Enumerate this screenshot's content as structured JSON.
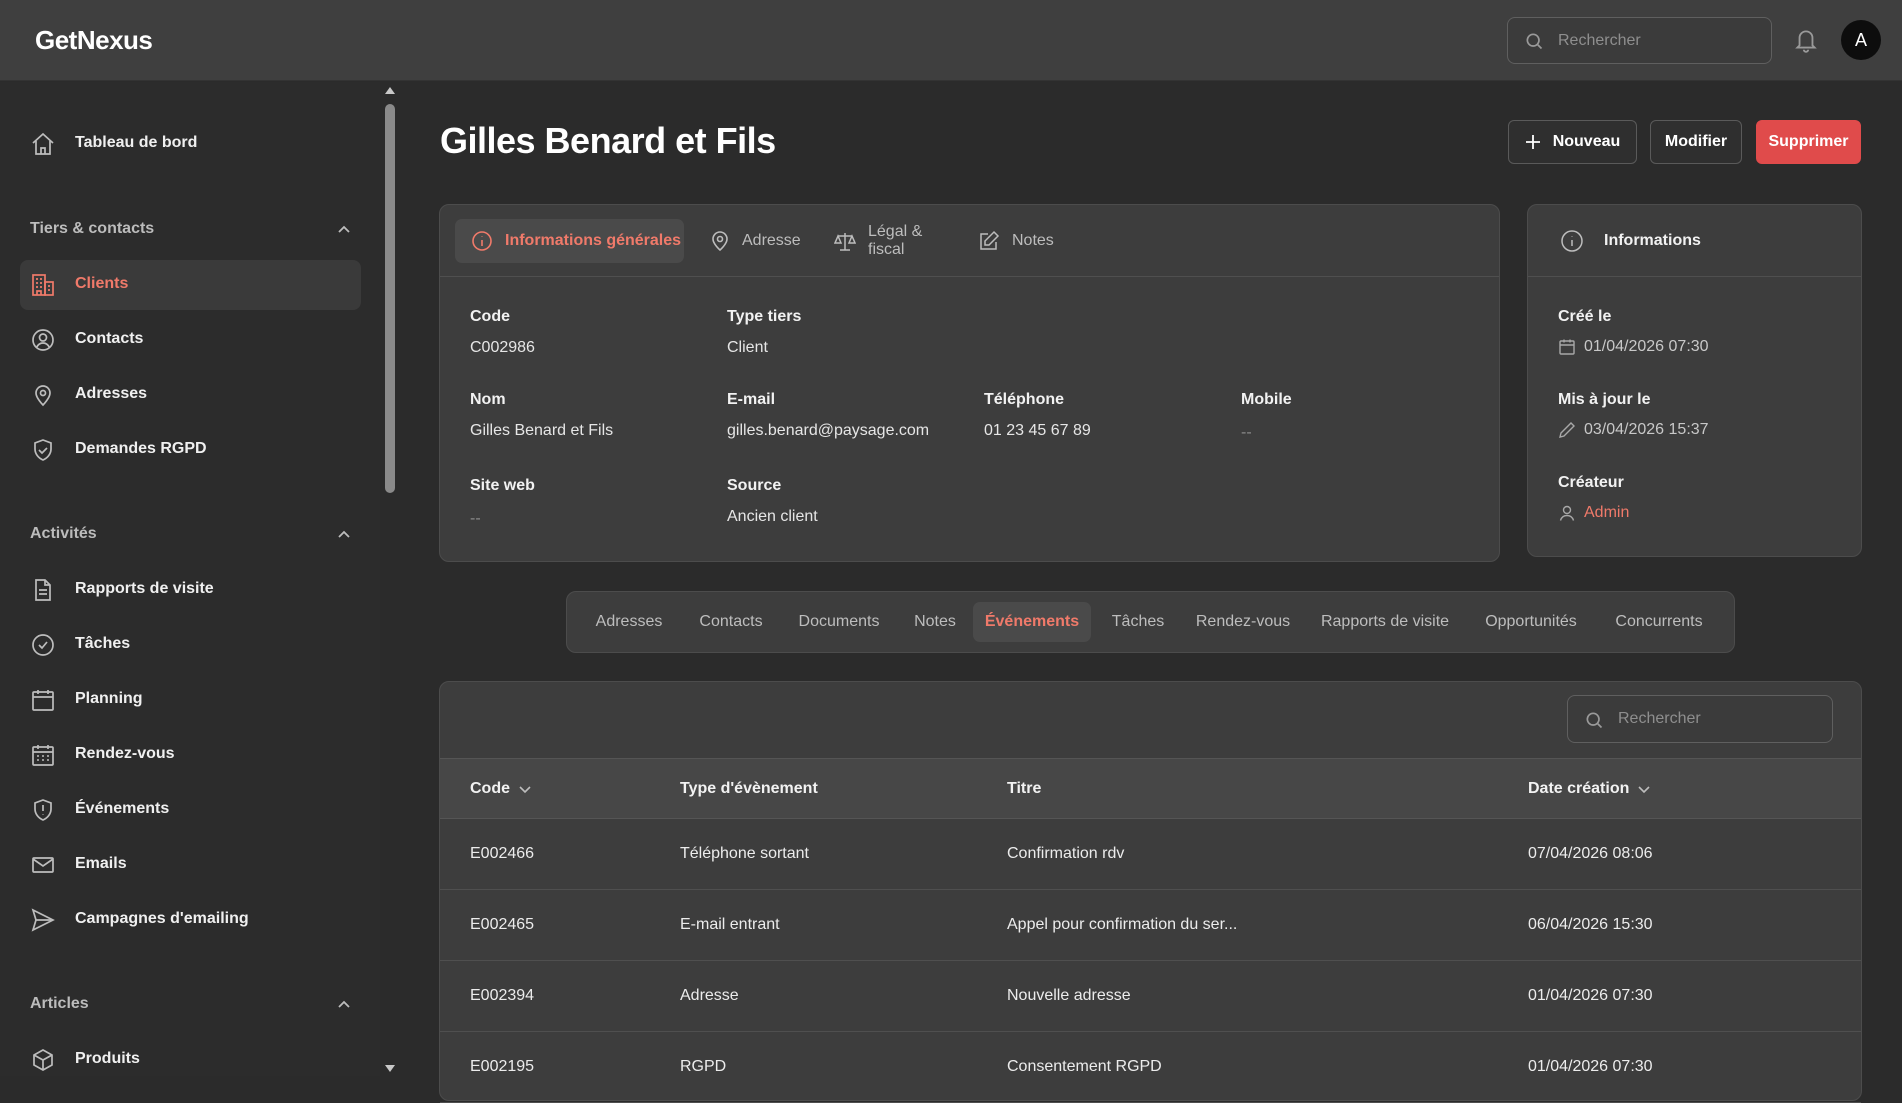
{
  "app": {
    "name": "GetNexus"
  },
  "topbar": {
    "search_placeholder": "Rechercher",
    "avatar_initial": "A"
  },
  "sidebar": {
    "dashboard": "Tableau de bord",
    "sections": [
      {
        "title": "Tiers & contacts",
        "items": [
          "Clients",
          "Contacts",
          "Adresses",
          "Demandes RGPD"
        ]
      },
      {
        "title": "Activités",
        "items": [
          "Rapports de visite",
          "Tâches",
          "Planning",
          "Rendez-vous",
          "Événements",
          "Emails",
          "Campagnes d'emailing"
        ]
      },
      {
        "title": "Articles",
        "items": [
          "Produits"
        ]
      }
    ],
    "active_item": "Clients"
  },
  "page": {
    "title": "Gilles Benard et Fils",
    "actions": {
      "new": "Nouveau",
      "edit": "Modifier",
      "delete": "Supprimer"
    }
  },
  "detail": {
    "tabs": [
      "Informations générales",
      "Adresse",
      "Légal & fiscal",
      "Notes"
    ],
    "active_tab": "Informations générales",
    "fields": {
      "code": {
        "label": "Code",
        "value": "C002986"
      },
      "type": {
        "label": "Type tiers",
        "value": "Client"
      },
      "nom": {
        "label": "Nom",
        "value": "Gilles Benard et Fils"
      },
      "email": {
        "label": "E-mail",
        "value": "gilles.benard@paysage.com"
      },
      "telephone": {
        "label": "Téléphone",
        "value": "01 23 45 67 89"
      },
      "mobile": {
        "label": "Mobile",
        "value": "--"
      },
      "site": {
        "label": "Site web",
        "value": "--"
      },
      "source": {
        "label": "Source",
        "value": "Ancien client"
      }
    }
  },
  "info_panel": {
    "title": "Informations",
    "created_label": "Créé le",
    "created_value": "01/04/2026 07:30",
    "updated_label": "Mis à jour le",
    "updated_value": "03/04/2026 15:37",
    "creator_label": "Créateur",
    "creator_value": "Admin"
  },
  "subtabs": {
    "items": [
      "Adresses",
      "Contacts",
      "Documents",
      "Notes",
      "Événements",
      "Tâches",
      "Rendez-vous",
      "Rapports de visite",
      "Opportunités",
      "Concurrents"
    ],
    "active": "Événements"
  },
  "events_table": {
    "search_placeholder": "Rechercher",
    "columns": [
      "Code",
      "Type d'évènement",
      "Titre",
      "Date création"
    ],
    "rows": [
      [
        "E002466",
        "Téléphone sortant",
        "Confirmation rdv",
        "07/04/2026 08:06"
      ],
      [
        "E002465",
        "E-mail entrant",
        "Appel pour confirmation du ser...",
        "06/04/2026 15:30"
      ],
      [
        "E002394",
        "Adresse",
        "Nouvelle adresse",
        "01/04/2026 07:30"
      ],
      [
        "E002195",
        "RGPD",
        "Consentement RGPD",
        "01/04/2026 07:30"
      ]
    ]
  },
  "colors": {
    "accent": "#f07a6a",
    "danger": "#e04b4b",
    "background": "#2b2b2b",
    "card": "#3d3d3d"
  }
}
